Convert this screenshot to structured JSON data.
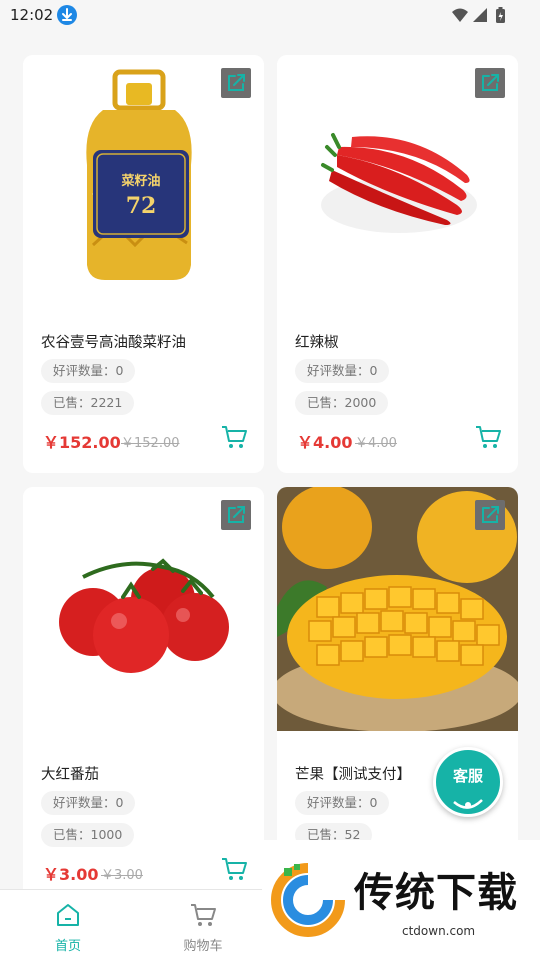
{
  "status_bar": {
    "time": "12:02"
  },
  "products": [
    {
      "title": "农谷壹号高油酸菜籽油",
      "reviews": "好评数量：0",
      "sold": "已售：2221",
      "price": "￥152.00",
      "old_price": "￥152.00",
      "image": "oil-bottle",
      "bottle_label": "菜籽油",
      "bottle_number": "72"
    },
    {
      "title": "红辣椒",
      "reviews": "好评数量：0",
      "sold": "已售：2000",
      "price": "￥4.00",
      "old_price": "￥4.00",
      "image": "red-chili"
    },
    {
      "title": "大红番茄",
      "reviews": "好评数量：0",
      "sold": "已售：1000",
      "price": "￥3.00",
      "old_price": "￥3.00",
      "image": "tomatoes"
    },
    {
      "title": "芒果【测试支付】",
      "reviews": "好评数量：0",
      "sold": "已售：52",
      "image": "mango"
    }
  ],
  "customer_service": {
    "label": "客服"
  },
  "bottom_nav": [
    {
      "label": "首页",
      "icon": "home-icon",
      "active": true
    },
    {
      "label": "购物车",
      "icon": "cart-icon",
      "active": false
    }
  ],
  "watermark": {
    "text": "传统下载",
    "url": "ctdown.com"
  },
  "colors": {
    "accent": "#16b3a7",
    "price": "#e53935",
    "background": "#f6f6f6"
  }
}
